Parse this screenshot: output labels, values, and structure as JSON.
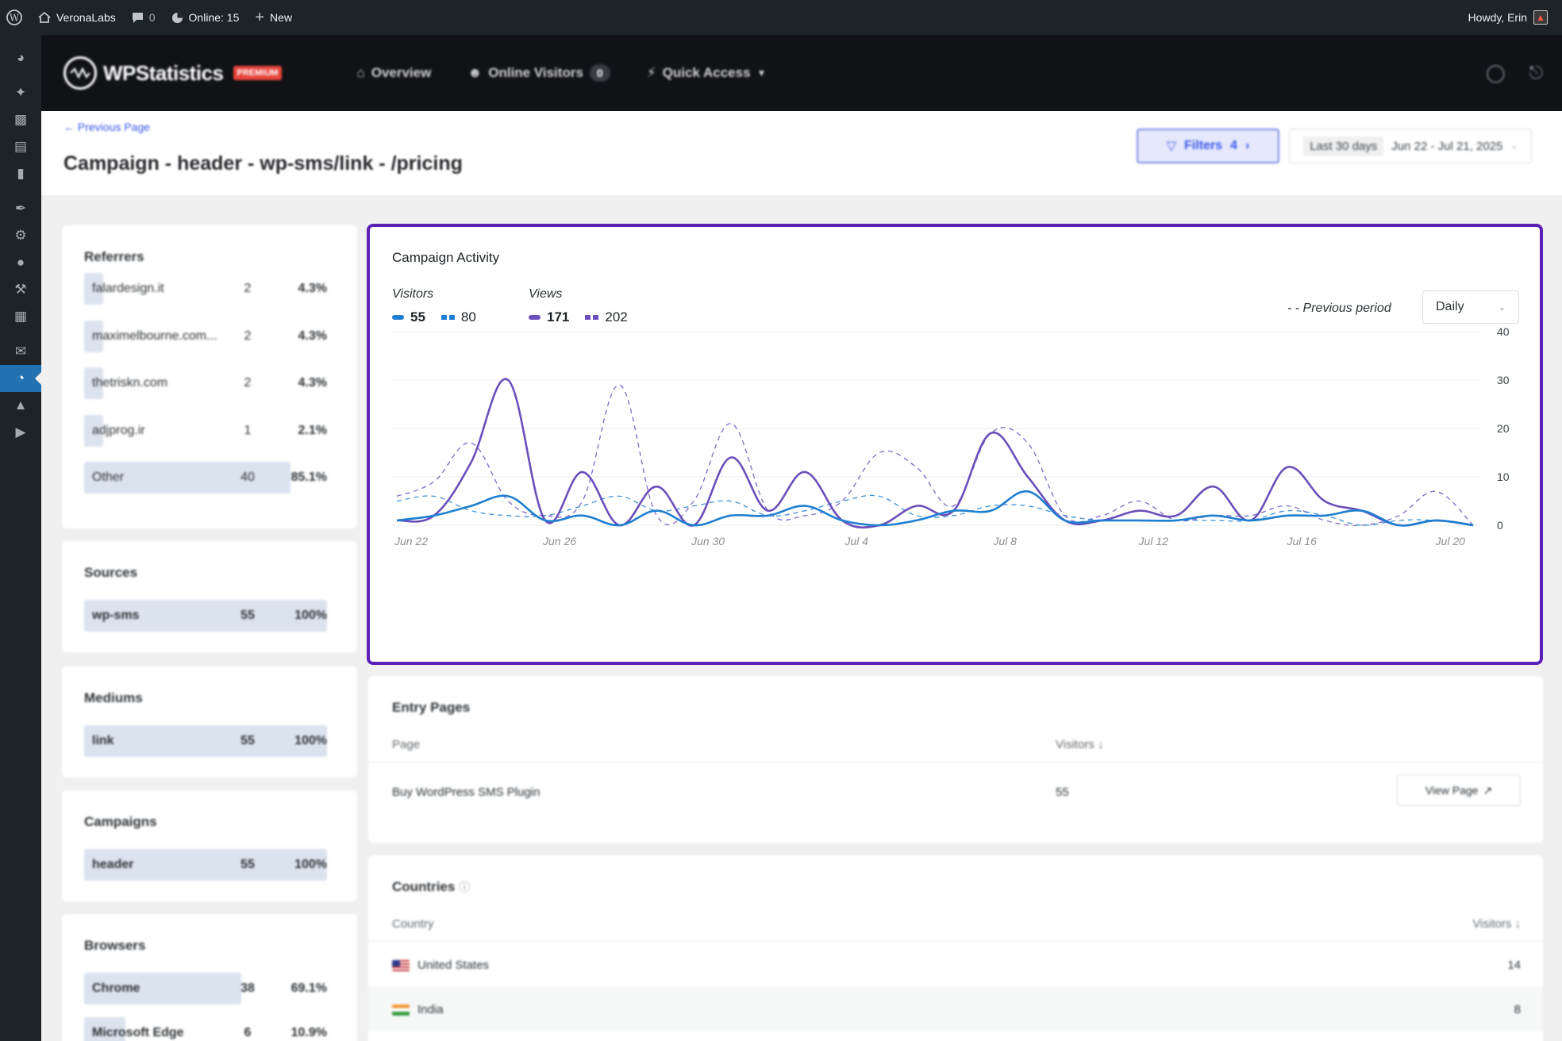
{
  "adminbar": {
    "site_name": "VeronaLabs",
    "comments_count": "0",
    "online": "Online: 15",
    "new": "New",
    "howdy": "Howdy, Erin"
  },
  "plugin": {
    "logo_text": "WPStatistics",
    "premium": "PREMIUM",
    "nav": {
      "overview": "Overview",
      "online_visitors": "Online Visitors",
      "online_visitors_count": "0",
      "quick_access": "Quick Access"
    }
  },
  "header": {
    "previous_page": "← Previous Page",
    "page_title": "Campaign - header - wp-sms/link - /pricing",
    "filters_label": "Filters",
    "filters_count": "4",
    "date_preset": "Last 30 days",
    "date_range": "Jun 22 - Jul 21, 2025"
  },
  "referrers": {
    "title": "Referrers",
    "rows": [
      {
        "name": "falardesign.it",
        "value": "2",
        "percent": "4.3%",
        "share": 0.043
      },
      {
        "name": "maximelbourne.com...",
        "value": "2",
        "percent": "4.3%",
        "share": 0.043
      },
      {
        "name": "thetriskn.com",
        "value": "2",
        "percent": "4.3%",
        "share": 0.043
      },
      {
        "name": "adjprog.ir",
        "value": "1",
        "percent": "2.1%",
        "share": 0.021
      },
      {
        "name": "Other",
        "value": "40",
        "percent": "85.1%",
        "share": 0.851
      }
    ]
  },
  "sources": {
    "title": "Sources",
    "rows": [
      {
        "name": "wp-sms",
        "value": "55",
        "percent": "100%",
        "share": 1.0
      }
    ]
  },
  "mediums": {
    "title": "Mediums",
    "rows": [
      {
        "name": "link",
        "value": "55",
        "percent": "100%",
        "share": 1.0
      }
    ]
  },
  "campaigns": {
    "title": "Campaigns",
    "rows": [
      {
        "name": "header",
        "value": "55",
        "percent": "100%",
        "share": 1.0
      }
    ]
  },
  "browsers": {
    "title": "Browsers",
    "rows": [
      {
        "name": "Chrome",
        "value": "38",
        "percent": "69.1%",
        "share": 0.691
      },
      {
        "name": "Microsoft Edge",
        "value": "6",
        "percent": "10.9%",
        "share": 0.109
      }
    ]
  },
  "activity": {
    "title": "Campaign Activity",
    "visitors_label": "Visitors",
    "views_label": "Views",
    "visitors_current": "55",
    "visitors_previous": "80",
    "views_current": "171",
    "views_previous": "202",
    "previous_period_label": "- -  Previous period",
    "interval": "Daily"
  },
  "chart_data": {
    "type": "line",
    "x": [
      "Jun 22",
      "Jun 23",
      "Jun 24",
      "Jun 25",
      "Jun 26",
      "Jun 27",
      "Jun 28",
      "Jun 29",
      "Jun 30",
      "Jul 1",
      "Jul 2",
      "Jul 3",
      "Jul 4",
      "Jul 5",
      "Jul 6",
      "Jul 7",
      "Jul 8",
      "Jul 9",
      "Jul 10",
      "Jul 11",
      "Jul 12",
      "Jul 13",
      "Jul 14",
      "Jul 15",
      "Jul 16",
      "Jul 17",
      "Jul 18",
      "Jul 19",
      "Jul 20",
      "Jul 21"
    ],
    "x_tick_labels": [
      "Jun 22",
      "Jun 26",
      "Jun 30",
      "Jul 4",
      "Jul 8",
      "Jul 12",
      "Jul 16",
      "Jul 20"
    ],
    "ylim": [
      0,
      40
    ],
    "y_ticks": [
      0,
      10,
      20,
      30,
      40
    ],
    "grid": true,
    "colors": {
      "visitors": "#1e7fd0",
      "views": "#6b4fbb"
    },
    "series": [
      {
        "name": "Views",
        "style": "solid",
        "values": [
          1,
          2,
          13,
          30,
          1,
          11,
          0,
          8,
          0,
          14,
          3,
          11,
          1,
          0,
          4,
          3,
          19,
          10,
          1,
          1,
          3,
          2,
          8,
          1,
          12,
          5,
          3,
          0,
          1,
          0
        ]
      },
      {
        "name": "Visitors",
        "style": "solid",
        "values": [
          1,
          2,
          4,
          6,
          1,
          2,
          0,
          3,
          0,
          2,
          2,
          4,
          1,
          0,
          1,
          3,
          3,
          7,
          1,
          1,
          1,
          1,
          2,
          1,
          2,
          2,
          3,
          0,
          1,
          0
        ]
      },
      {
        "name": "Views",
        "style": "dashed",
        "values": [
          6,
          9,
          17,
          5,
          2,
          5,
          29,
          2,
          5,
          21,
          3,
          2,
          5,
          15,
          12,
          4,
          19,
          17,
          2,
          2,
          5,
          1,
          2,
          2,
          4,
          1,
          0,
          2,
          7,
          0
        ]
      },
      {
        "name": "Visitors",
        "style": "dashed",
        "values": [
          5,
          6,
          3,
          2,
          2,
          4,
          6,
          3,
          4,
          5,
          2,
          3,
          5,
          6,
          2,
          2,
          4,
          4,
          2,
          1,
          1,
          1,
          1,
          1,
          3,
          2,
          0,
          1,
          1,
          0
        ]
      }
    ]
  },
  "entry_pages": {
    "title": "Entry Pages",
    "col_page": "Page",
    "col_visitors": "Visitors ↓",
    "rows": [
      {
        "page": "Buy WordPress SMS Plugin",
        "visitors": "55",
        "action": "View Page"
      }
    ]
  },
  "countries": {
    "title": "Countries",
    "col_country": "Country",
    "col_visitors": "Visitors ↓",
    "rows": [
      {
        "country": "United States",
        "visitors": "14"
      },
      {
        "country": "India",
        "visitors": "8"
      }
    ]
  }
}
